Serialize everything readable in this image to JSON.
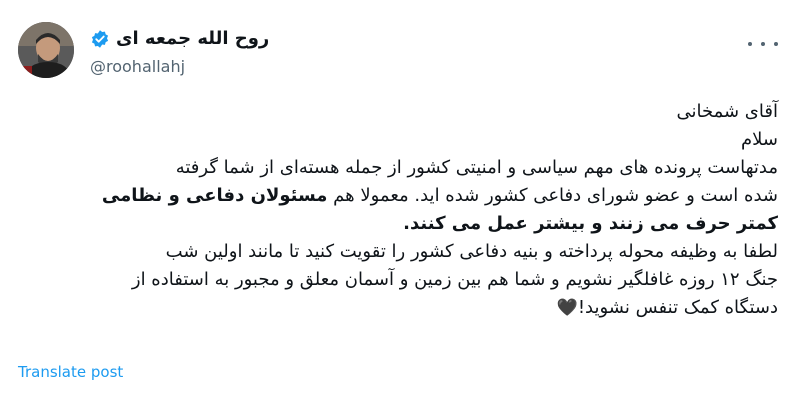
{
  "author": {
    "display_name": "روح الله جمعه ای",
    "handle": "@roohallahj",
    "verified": true,
    "verified_color": "#1d9bf0"
  },
  "tweet": {
    "greeting": "آقای شمخانی",
    "salam": "سلام",
    "line1": "مدتهاست پرونده های مهم سیاسی و امنیتی کشور از جمله هسته‌ای از شما گرفته",
    "line2_normal": "شده است و عضو شورای دفاعی کشور شده اید. معمولا هم ",
    "line2_bold": "مسئولان دفاعی و نظامی",
    "line3_bold": "کمتر حرف می زنند و بیشتر عمل می کنند.",
    "line4": "لطفا به وظیفه محوله پرداخته و بنیه دفاعی کشور را تقویت کنید تا مانند اولین شب",
    "line5": "جنگ ۱۲ روزه غافلگیر نشویم و شما هم بین زمین و آسمان معلق و مجبور به استفاده از",
    "line6": "دستگاه کمک تنفس نشوید!",
    "emoji": "🖤"
  },
  "actions": {
    "translate_label": "Translate post",
    "more_icon": "more-horizontal-icon"
  },
  "colors": {
    "link": "#1d9bf0",
    "secondary_text": "#536471",
    "primary_text": "#0f1419"
  }
}
